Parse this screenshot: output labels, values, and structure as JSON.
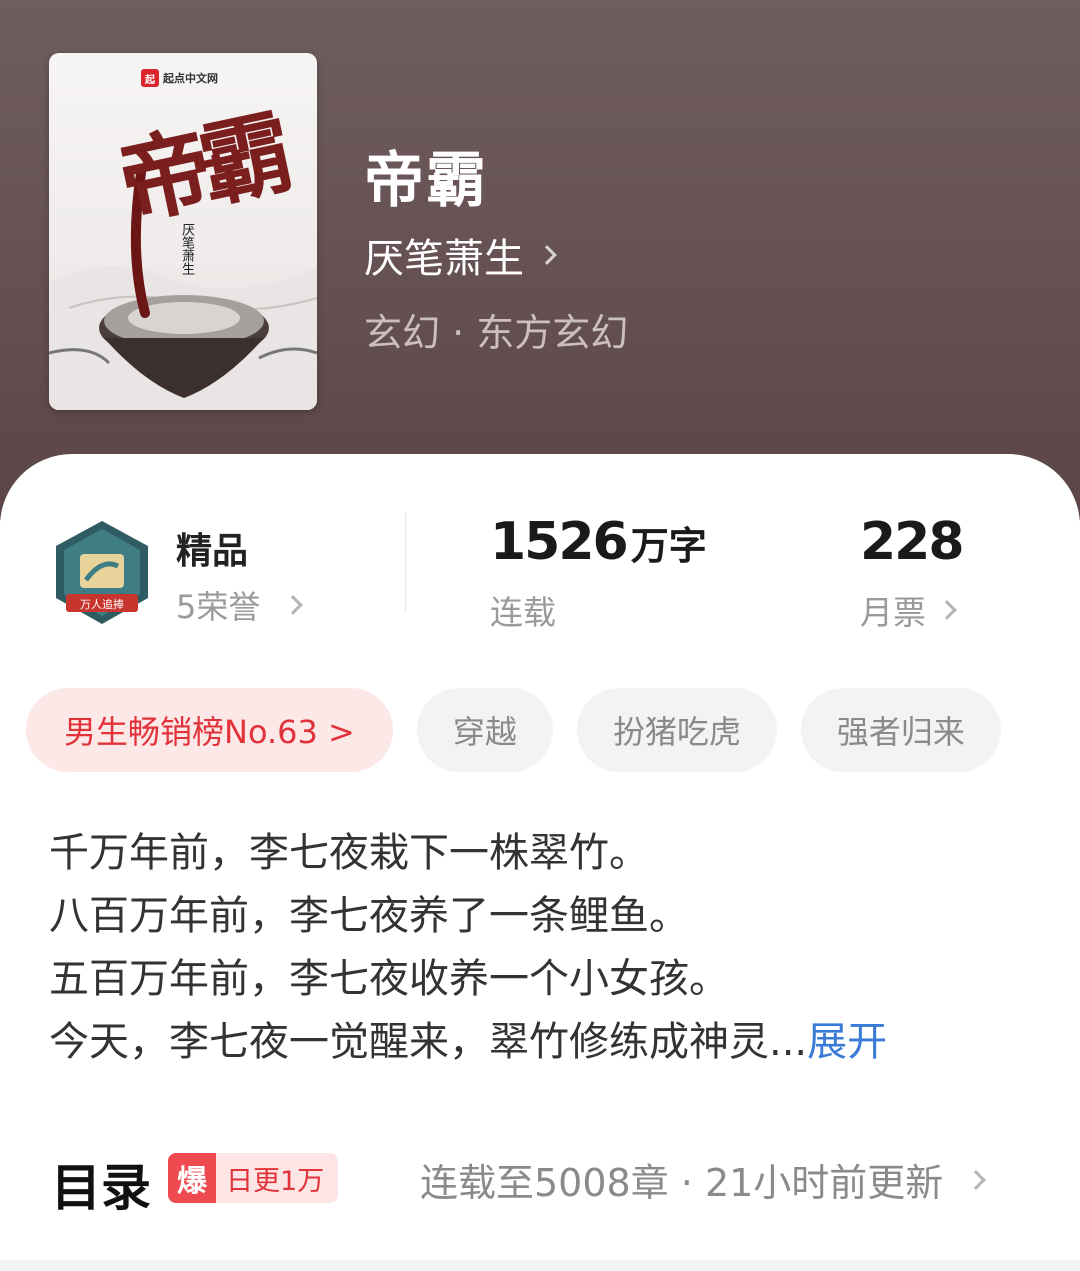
{
  "book": {
    "title": "帝霸",
    "author": "厌笔萧生",
    "genre": "玄幻 · 东方玄幻",
    "cover": {
      "publisher": "起点中文网",
      "publisher_logo_char": "起",
      "title_text": "帝霸",
      "author_text": "厌笔萧生"
    }
  },
  "stats": {
    "quality_label": "精品",
    "badge_text": "万人追捧",
    "honors_label": "5荣誉",
    "word_count": "1526",
    "word_count_unit": "万字",
    "status_label": "连载",
    "monthly_tickets": "228",
    "monthly_tickets_label": "月票"
  },
  "tags": {
    "rank": "男生畅销榜No.63 >",
    "items": [
      "穿越",
      "扮猪吃虎",
      "强者归来"
    ]
  },
  "synopsis": {
    "lines": [
      "千万年前，李七夜栽下一株翠竹。",
      "八百万年前，李七夜养了一条鲤鱼。",
      "五百万年前，李七夜收养一个小女孩。",
      "今天，李七夜一觉醒来，翠竹修练成神灵..."
    ],
    "expand_label": "展开"
  },
  "toc": {
    "title": "目录",
    "hot_icon": "爆",
    "update_badge": "日更1万",
    "status": "连载至5008章 · 21小时前更新"
  },
  "colors": {
    "accent_red": "#e2323a",
    "link_blue": "#3a7bd5",
    "hero_bg": "#675355"
  },
  "icons": [
    "chevron-right-icon",
    "honor-badge-icon",
    "hot-icon"
  ]
}
